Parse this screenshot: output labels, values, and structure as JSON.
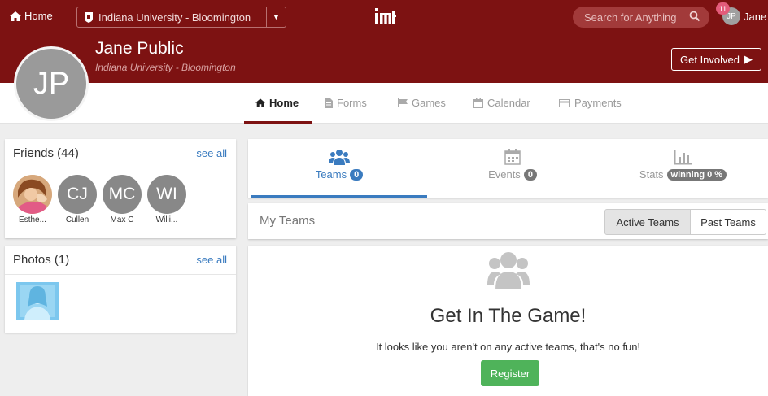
{
  "topbar": {
    "home_label": "Home",
    "school_label": "Indiana University - Bloomington",
    "search_placeholder": "Search for Anything",
    "notification_count": "11",
    "user_initials": "JP",
    "user_name": "Jane"
  },
  "profile": {
    "initials": "JP",
    "name": "Jane Public",
    "school": "Indiana University - Bloomington",
    "get_involved_label": "Get Involved"
  },
  "nav": {
    "tabs": [
      {
        "label": "Home",
        "icon": "home-icon",
        "active": true
      },
      {
        "label": "Forms",
        "icon": "document-icon"
      },
      {
        "label": "Games",
        "icon": "flag-icon"
      },
      {
        "label": "Calendar",
        "icon": "calendar-icon"
      },
      {
        "label": "Payments",
        "icon": "credit-card-icon"
      }
    ]
  },
  "friends": {
    "title": "Friends (44)",
    "see_all": "see all",
    "items": [
      {
        "initials": "",
        "name": "Esthe...",
        "photo": true
      },
      {
        "initials": "CJ",
        "name": "Cullen"
      },
      {
        "initials": "MC",
        "name": "Max C"
      },
      {
        "initials": "WI",
        "name": "Willi..."
      }
    ]
  },
  "photos": {
    "title": "Photos (1)",
    "see_all": "see all"
  },
  "stats_tabs": [
    {
      "label": "Teams",
      "count": "0",
      "icon": "users-icon",
      "active": true
    },
    {
      "label": "Events",
      "count": "0",
      "icon": "calendar-icon"
    },
    {
      "label": "Stats",
      "count": "winning 0 %",
      "icon": "bar-chart-icon"
    }
  ],
  "my_teams": {
    "title": "My Teams",
    "active_label": "Active Teams",
    "past_label": "Past Teams"
  },
  "empty_state": {
    "title": "Get In The Game!",
    "text": "It looks like you aren't on any active teams, that's no fun!",
    "register_label": "Register"
  },
  "colors": {
    "brand": "#7d1212",
    "accent": "#3a7bbf",
    "success": "#4fb35a"
  }
}
